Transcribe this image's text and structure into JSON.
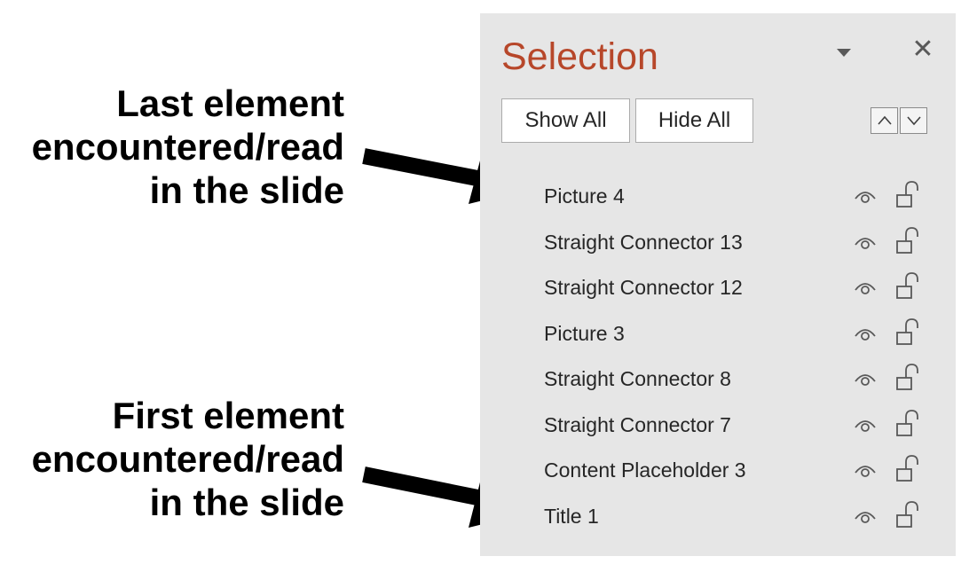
{
  "annotations": {
    "last": {
      "lines": [
        "Last element",
        "encountered/read",
        "in the slide"
      ]
    },
    "first": {
      "lines": [
        "First element",
        "encountered/read",
        "in the slide"
      ]
    }
  },
  "pane": {
    "title": "Selection",
    "options_icon": "triangle-down-icon",
    "close_label": "✕",
    "show_all_label": "Show All",
    "hide_all_label": "Hide All",
    "bring_forward_icon": "chevron-up-icon",
    "send_backward_icon": "chevron-down-icon",
    "items": [
      {
        "label": "Picture 4",
        "visible": true,
        "locked": false
      },
      {
        "label": "Straight Connector 13",
        "visible": true,
        "locked": false
      },
      {
        "label": "Straight Connector 12",
        "visible": true,
        "locked": false
      },
      {
        "label": "Picture 3",
        "visible": true,
        "locked": false
      },
      {
        "label": "Straight Connector 8",
        "visible": true,
        "locked": false
      },
      {
        "label": "Straight Connector 7",
        "visible": true,
        "locked": false
      },
      {
        "label": "Content Placeholder 3",
        "visible": true,
        "locked": false
      },
      {
        "label": "Title 1",
        "visible": true,
        "locked": false
      }
    ]
  },
  "colors": {
    "pane_background": "#e6e6e6",
    "title_accent": "#b7472a",
    "text": "#262626",
    "icon": "#595959",
    "annotation_text": "#000000"
  }
}
